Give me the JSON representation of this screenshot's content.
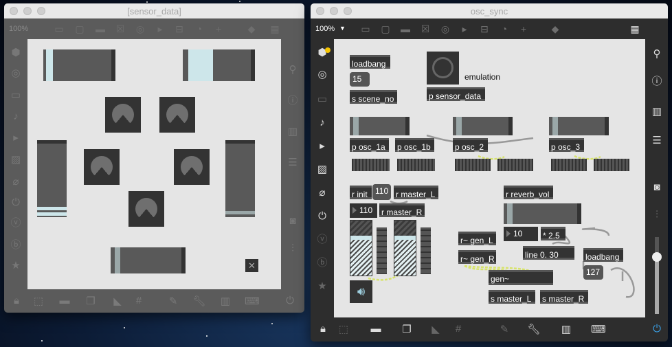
{
  "left_window": {
    "title": "[sensor_data]",
    "zoom": "100%",
    "toolbar_icons": [
      "presentation-icon",
      "message-icon",
      "comment-icon",
      "toggle-icon",
      "button-icon",
      "play-icon",
      "slider-icon",
      "dial-icon",
      "add-icon",
      "paint-bucket-icon",
      "grid-icon"
    ],
    "left_sidebar_icons": [
      "cube-icon",
      "target-icon",
      "bench-icon",
      "note-icon",
      "step-icon",
      "image-icon",
      "clip-icon",
      "plug-icon",
      "v-icon",
      "b-icon",
      "star-icon"
    ],
    "right_sidebar_icons": [
      "search-icon",
      "info-icon",
      "book-icon",
      "list-icon",
      "camera-icon",
      "mixer-icon"
    ],
    "bottom_icons": [
      "lock-icon",
      "select-icon",
      "presentation-icon",
      "windows-icon",
      "hide-icon",
      "grid-icon",
      "wand-icon",
      "wrench-icon",
      "piano-icon",
      "keyboard-icon",
      "power-icon"
    ]
  },
  "right_window": {
    "title": "osc_sync",
    "zoom": "100%",
    "accent": "#f5c400",
    "patch": {
      "loadbang_1": "loadbang",
      "scene_number": "15",
      "send_scene": "s scene_no",
      "emulation_label": "emulation",
      "sensor_data": "p sensor_data",
      "osc_1a": "p osc_1a",
      "osc_1b": "p osc_1b",
      "osc_2": "p osc_2",
      "osc_3": "p osc_3",
      "r_init": "r init",
      "msg_110": "110",
      "r_master_L": "r master_L",
      "num_110": "110",
      "r_master_R": "r master_R",
      "r_reverb_vol": "r reverb_vol",
      "num_10": "10",
      "mult": "* 2.5",
      "r_gen_L": "r~ gen_L",
      "r_gen_R": "r~ gen_R",
      "line": "line 0. 30",
      "loadbang_2": "loadbang",
      "msg_127": "127",
      "gen": "gen~",
      "s_master_L": "s master_L",
      "s_master_R": "s master_R"
    }
  }
}
